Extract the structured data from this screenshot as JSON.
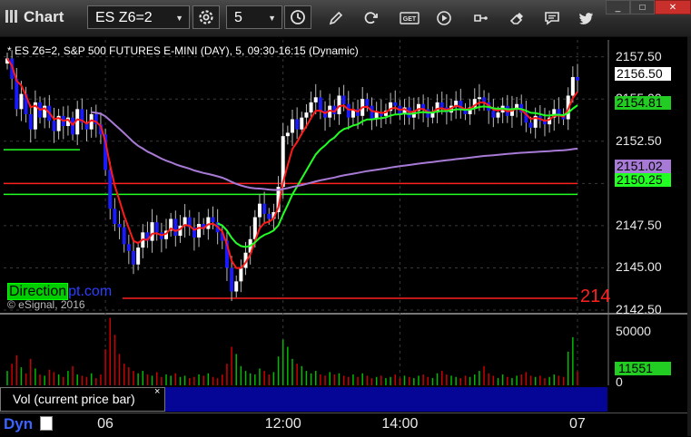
{
  "window": {
    "title": "Chart",
    "symbol": "ES Z6=2",
    "interval": "5",
    "controls": {
      "minimize": "_",
      "maximize": "□",
      "close": "✕"
    }
  },
  "toolbar": {
    "icons": [
      "gear-icon",
      "clock-icon",
      "pencil-icon",
      "refresh-icon",
      "get-icon",
      "play-icon",
      "link-icon",
      "chat-icon",
      "twitter-icon"
    ],
    "get_label": "GET"
  },
  "chart": {
    "description": "* ES Z6=2, S&P 500 FUTURES E-MINI (DAY), 5, 09:30-16:15 (Dynamic)",
    "watermark_box": "Direction",
    "watermark_rest": "pt.com",
    "copyright": "© eSignal, 2016",
    "edge_label": "214",
    "dyn_label": "Dyn"
  },
  "chart_data": {
    "type": "candlestick",
    "y_axis": {
      "ticks": [
        "2157.50",
        "2155.00",
        "2152.50",
        "2150.00",
        "2147.50",
        "2145.00",
        "2142.50"
      ],
      "ylim": [
        2142.5,
        2158.5
      ]
    },
    "x_axis": {
      "ticks": [
        "06",
        "12:00",
        "14:00",
        "07"
      ]
    },
    "price_tags": [
      {
        "value": "2156.50",
        "price": 2156.5,
        "bg": "#ffffff",
        "fg": "#000000"
      },
      {
        "value": "2154.81",
        "price": 2154.81,
        "bg": "#22cc22",
        "fg": "#000000"
      },
      {
        "value": "2151.02",
        "price": 2151.02,
        "bg": "#a77ad6",
        "fg": "#000000"
      },
      {
        "value": "2150.25",
        "price": 2150.25,
        "bg": "#22ff22",
        "fg": "#000000"
      }
    ],
    "levels": [
      {
        "price": 2150.0,
        "color": "#ff2020"
      },
      {
        "price": 2143.2,
        "color": "#ff2020"
      },
      {
        "price": 2149.35,
        "color": "#22ff22"
      }
    ],
    "closes": [
      2157.4,
      2156.2,
      2154.4,
      2155.3,
      2154.1,
      2153.2,
      2154.8,
      2153.9,
      2154.6,
      2153.7,
      2153.1,
      2154.0,
      2153.4,
      2153.9,
      2152.9,
      2154.4,
      2153.6,
      2153.2,
      2154.1,
      2153.5,
      2152.9,
      2150.8,
      2148.5,
      2147.6,
      2147.4,
      2146.4,
      2146.0,
      2145.2,
      2146.2,
      2147.1,
      2146.6,
      2147.7,
      2147.1,
      2146.7,
      2147.2,
      2147.9,
      2146.9,
      2147.5,
      2148.0,
      2147.4,
      2146.8,
      2147.6,
      2147.3,
      2148.0,
      2147.7,
      2147.1,
      2146.6,
      2145.0,
      2143.6,
      2144.2,
      2145.0,
      2145.9,
      2146.7,
      2148.0,
      2148.8,
      2148.2,
      2147.9,
      2148.3,
      2149.8,
      2152.8,
      2153.0,
      2153.8,
      2153.2,
      2153.9,
      2154.2,
      2154.8,
      2155.1,
      2154.3,
      2153.9,
      2154.6,
      2154.1,
      2155.2,
      2154.7,
      2153.9,
      2154.4,
      2154.0,
      2155.0,
      2154.6,
      2153.8,
      2154.2,
      2154.0,
      2154.3,
      2154.8,
      2154.6,
      2154.1,
      2154.5,
      2153.9,
      2154.3,
      2154.7,
      2154.4,
      2153.9,
      2154.2,
      2154.8,
      2154.5,
      2154.2,
      2154.6,
      2154.9,
      2154.4,
      2154.1,
      2154.5,
      2155.0,
      2155.1,
      2154.8,
      2154.3,
      2153.9,
      2154.2,
      2154.6,
      2154.0,
      2154.4,
      2154.7,
      2154.2,
      2153.6,
      2153.3,
      2154.0,
      2153.7,
      2153.5,
      2153.9,
      2154.4,
      2154.1,
      2153.8,
      2155.2,
      2156.3,
      2156.1
    ],
    "volume_ylim": [
      0,
      58000
    ],
    "volume_ticks": [
      "50000",
      "0"
    ],
    "volume_last": "11551",
    "volume_label": "Vol (current price bar)",
    "volume_close": "×",
    "volumes": [
      12000,
      18000,
      25000,
      15000,
      10000,
      22000,
      14000,
      9000,
      8000,
      13000,
      11000,
      9000,
      7000,
      12000,
      16000,
      9000,
      8000,
      7000,
      10000,
      6000,
      9000,
      30000,
      56000,
      42000,
      26000,
      18000,
      15000,
      12000,
      10000,
      12000,
      9000,
      8000,
      11000,
      7000,
      9000,
      8000,
      10000,
      7000,
      8000,
      6000,
      7000,
      9000,
      8000,
      10000,
      7000,
      6000,
      9000,
      18000,
      32000,
      26000,
      16000,
      12000,
      10000,
      9000,
      14000,
      12000,
      9000,
      11000,
      24000,
      38000,
      32000,
      22000,
      18000,
      16000,
      12000,
      10000,
      12000,
      9000,
      8000,
      11000,
      9000,
      10000,
      8000,
      7000,
      9000,
      7000,
      10000,
      8000,
      6000,
      7000,
      8000,
      6000,
      7000,
      9000,
      6000,
      8000,
      7000,
      6000,
      8000,
      9000,
      7000,
      6000,
      10000,
      12000,
      9000,
      8000,
      7000,
      6000,
      8000,
      7000,
      9000,
      12000,
      16000,
      10000,
      8000,
      6000,
      9000,
      7000,
      6000,
      8000,
      9000,
      11000,
      8000,
      7000,
      8000,
      6000,
      7000,
      9000,
      8000,
      7000,
      28000,
      40000,
      11551
    ],
    "colors": {
      "up": "#ffffff",
      "down": "#1a1aff",
      "ma_fast": "#ff1a1a",
      "ma_slow": "#22ff22",
      "vwap": "#a77ad6",
      "vol": [
        "#00bb00",
        "#cc0000"
      ]
    }
  }
}
